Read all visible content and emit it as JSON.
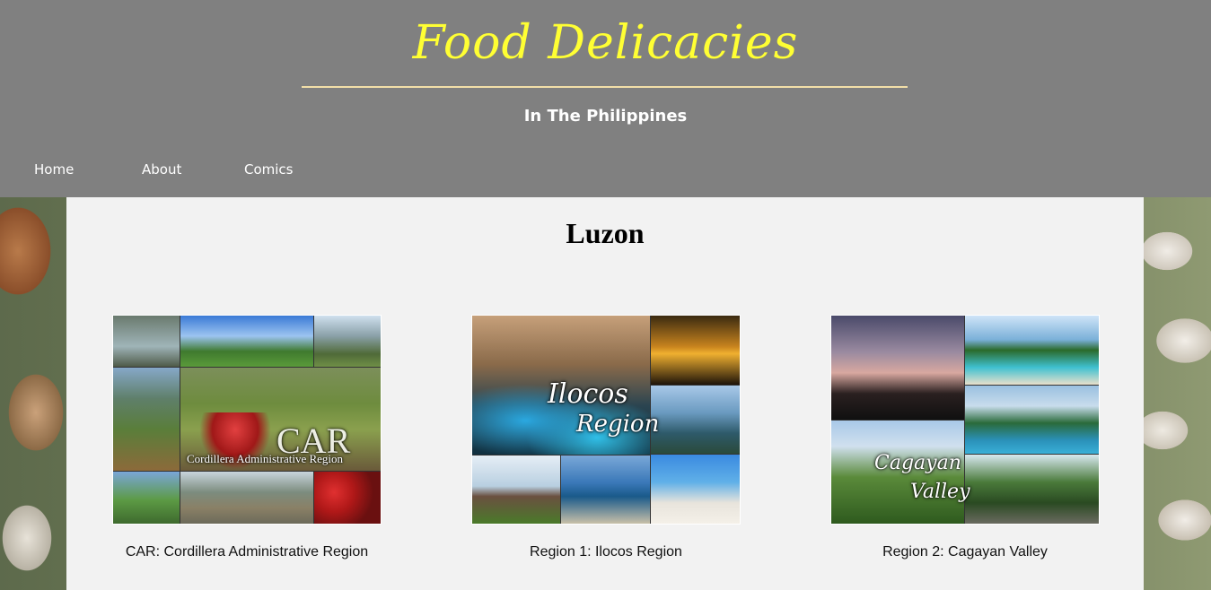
{
  "header": {
    "title": "Food Delicacies",
    "subtitle": "In The Philippines"
  },
  "nav": {
    "items": [
      {
        "label": "Home"
      },
      {
        "label": "About"
      },
      {
        "label": "Comics"
      }
    ]
  },
  "main": {
    "section_title": "Luzon",
    "regions": [
      {
        "caption": "CAR: Cordillera Administrative Region",
        "image_text": "CAR",
        "image_subtext": "Cordillera Administrative Region"
      },
      {
        "caption": "Region 1: Ilocos Region",
        "image_text": "Ilocos",
        "image_subtext": "Region"
      },
      {
        "caption": "Region 2: Cagayan Valley",
        "image_text": "Cagayan",
        "image_subtext": "Valley"
      }
    ]
  },
  "colors": {
    "header_bg": "#808080",
    "title": "#ffff33",
    "content_bg": "#f2f2f2"
  }
}
